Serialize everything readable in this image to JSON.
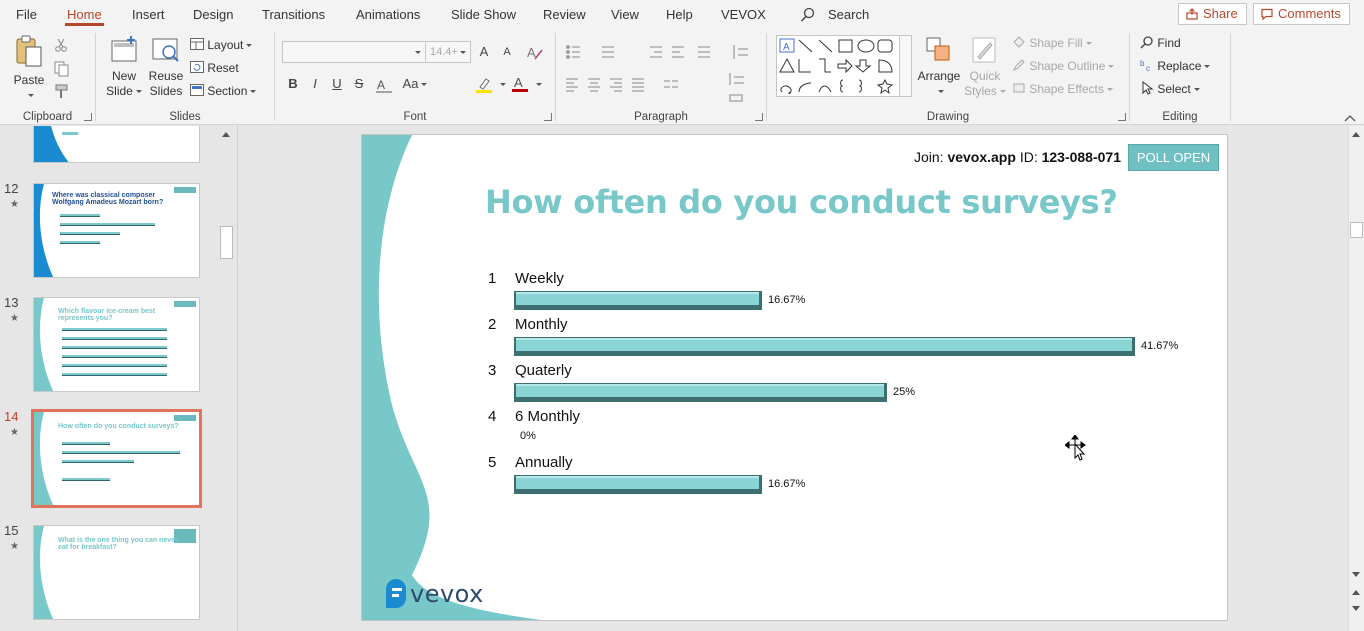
{
  "tabs": [
    "File",
    "Home",
    "Insert",
    "Design",
    "Transitions",
    "Animations",
    "Slide Show",
    "Review",
    "View",
    "Help",
    "VEVOX"
  ],
  "active_tab": "Home",
  "search": {
    "label": "Search"
  },
  "share": {
    "label": "Share"
  },
  "comments": {
    "label": "Comments"
  },
  "ribbon": {
    "clipboard": {
      "label": "Clipboard",
      "paste": "Paste"
    },
    "slides": {
      "label": "Slides",
      "new_slide_1": "New",
      "new_slide_2": "Slide",
      "reuse_1": "Reuse",
      "reuse_2": "Slides",
      "layout": "Layout",
      "reset": "Reset",
      "section": "Section"
    },
    "font": {
      "label": "Font",
      "size": "14.4+",
      "bold": "B",
      "italic": "I",
      "underline": "U",
      "strike": "S",
      "case": "Aa",
      "grow": "A",
      "shrink": "A"
    },
    "paragraph": {
      "label": "Paragraph"
    },
    "drawing": {
      "label": "Drawing",
      "arrange": "Arrange",
      "quick_1": "Quick",
      "quick_2": "Styles",
      "fill": "Shape Fill",
      "outline": "Shape Outline",
      "effects": "Shape Effects"
    },
    "editing": {
      "label": "Editing",
      "find": "Find",
      "replace": "Replace",
      "select": "Select"
    }
  },
  "thumbnails": [
    {
      "num": "",
      "star": false
    },
    {
      "num": "12",
      "star": true,
      "title": "Where was classical composer Wolfgang Amadeus Mozart born?"
    },
    {
      "num": "13",
      "star": true,
      "title": "Which flavour ice-cream best represents you?"
    },
    {
      "num": "14",
      "star": true,
      "title": "How often do you conduct surveys?"
    },
    {
      "num": "15",
      "star": true,
      "title": "What is the one thing you can never eat for breakfast?"
    }
  ],
  "slide": {
    "join_prefix": "Join:",
    "join_site": "vevox.app",
    "join_id_label": "ID:",
    "join_id": "123-088-071",
    "poll_status": "POLL OPEN",
    "title": "How often do you conduct surveys?",
    "brand": "vevox",
    "colors": {
      "accent": "#78c7c9",
      "bar_fill": "#8ad4d6",
      "bar_shadow": "#3e6f70"
    }
  },
  "chart_data": {
    "type": "bar",
    "orientation": "horizontal",
    "title": "How often do you conduct surveys?",
    "categories": [
      "Weekly",
      "Monthly",
      "Quaterly",
      "6 Monthly",
      "Annually"
    ],
    "numbers": [
      "1",
      "2",
      "3",
      "4",
      "5"
    ],
    "values": [
      16.67,
      41.67,
      25,
      0,
      16.67
    ],
    "labels": [
      "16.67%",
      "41.67%",
      "25%",
      "0%",
      "16.67%"
    ],
    "xlim": [
      0,
      41.67
    ]
  }
}
